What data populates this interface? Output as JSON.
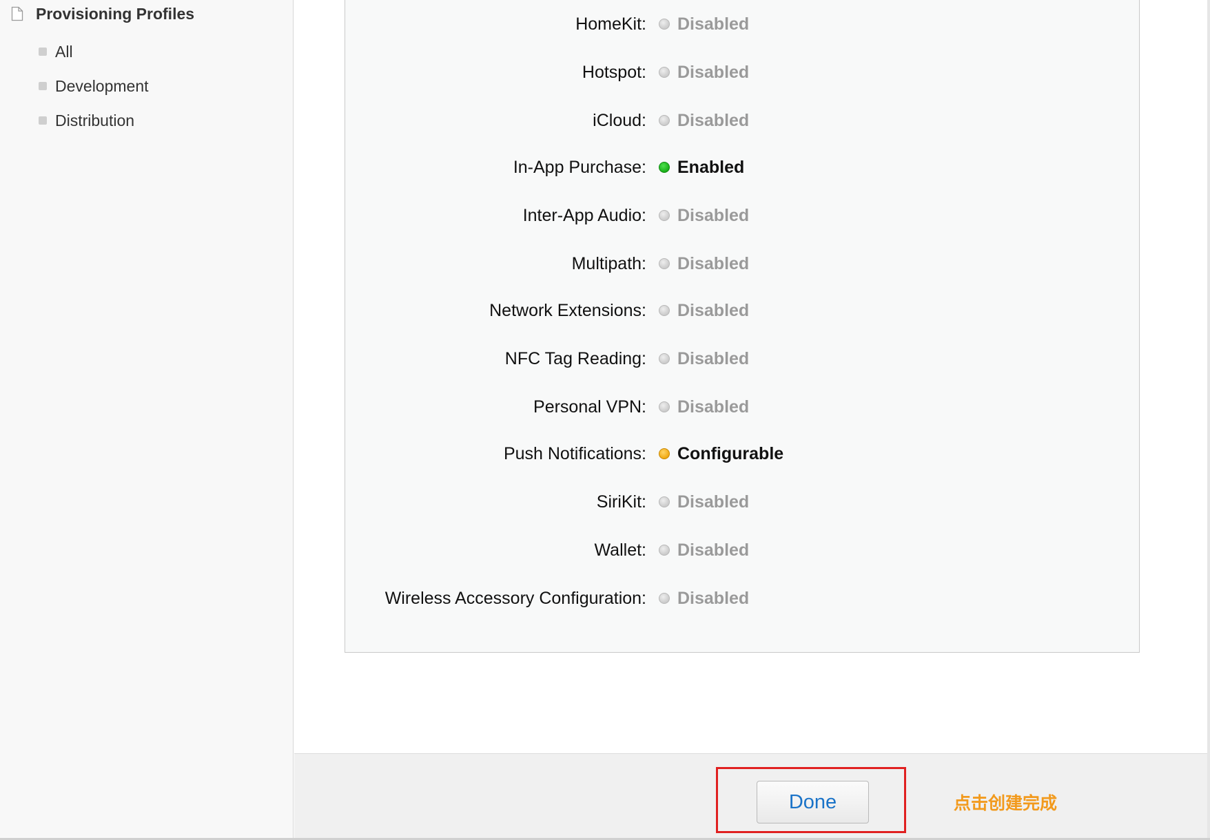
{
  "sidebar": {
    "section_title": "Provisioning Profiles",
    "section_icon": "document-icon",
    "items": [
      {
        "label": "All"
      },
      {
        "label": "Development"
      },
      {
        "label": "Distribution"
      }
    ]
  },
  "capabilities": [
    {
      "label": "HomeKit:",
      "status": "Disabled",
      "state": "disabled"
    },
    {
      "label": "Hotspot:",
      "status": "Disabled",
      "state": "disabled"
    },
    {
      "label": "iCloud:",
      "status": "Disabled",
      "state": "disabled"
    },
    {
      "label": "In-App Purchase:",
      "status": "Enabled",
      "state": "enabled"
    },
    {
      "label": "Inter-App Audio:",
      "status": "Disabled",
      "state": "disabled"
    },
    {
      "label": "Multipath:",
      "status": "Disabled",
      "state": "disabled"
    },
    {
      "label": "Network Extensions:",
      "status": "Disabled",
      "state": "disabled"
    },
    {
      "label": "NFC Tag Reading:",
      "status": "Disabled",
      "state": "disabled"
    },
    {
      "label": "Personal VPN:",
      "status": "Disabled",
      "state": "disabled"
    },
    {
      "label": "Push Notifications:",
      "status": "Configurable",
      "state": "configurable"
    },
    {
      "label": "SiriKit:",
      "status": "Disabled",
      "state": "disabled"
    },
    {
      "label": "Wallet:",
      "status": "Disabled",
      "state": "disabled"
    },
    {
      "label": "Wireless Accessory Configuration:",
      "status": "Disabled",
      "state": "disabled"
    }
  ],
  "status_colors": {
    "disabled": "#cfcfcf",
    "enabled": "#22b522",
    "configurable": "#f0a913"
  },
  "footer": {
    "done_label": "Done",
    "annotation": "点击创建完成",
    "annotation_color": "#f29a1d",
    "highlight_color": "#e02020"
  }
}
